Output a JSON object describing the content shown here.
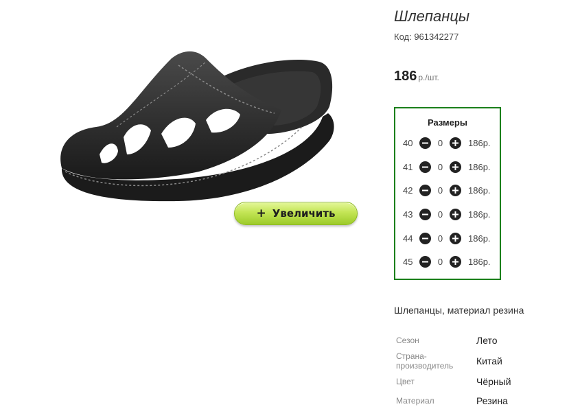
{
  "product": {
    "title": "Шлепанцы",
    "code_label": "Код: 961342277",
    "price": "186",
    "price_unit": "р./шт.",
    "description": "Шлепанцы, материал резина"
  },
  "zoom_button": {
    "icon": "+",
    "label": "Увеличить"
  },
  "sizes": {
    "title": "Размеры",
    "rows": [
      {
        "size": "40",
        "qty": "0",
        "price": "186р."
      },
      {
        "size": "41",
        "qty": "0",
        "price": "186р."
      },
      {
        "size": "42",
        "qty": "0",
        "price": "186р."
      },
      {
        "size": "43",
        "qty": "0",
        "price": "186р."
      },
      {
        "size": "44",
        "qty": "0",
        "price": "186р."
      },
      {
        "size": "45",
        "qty": "0",
        "price": "186р."
      }
    ]
  },
  "properties": [
    {
      "label": "Сезон",
      "value": "Лето"
    },
    {
      "label": "Страна-производитель",
      "label_line1": "Страна-",
      "label_line2": "производитель",
      "value": "Китай"
    },
    {
      "label": "Цвет",
      "value": "Чёрный"
    },
    {
      "label": "Материал",
      "value": "Резина"
    }
  ],
  "colors": {
    "sizes_border": "#1a7f1a",
    "button_green": "#c3e555"
  },
  "icons": [
    "minus-circle-icon",
    "plus-circle-icon"
  ]
}
